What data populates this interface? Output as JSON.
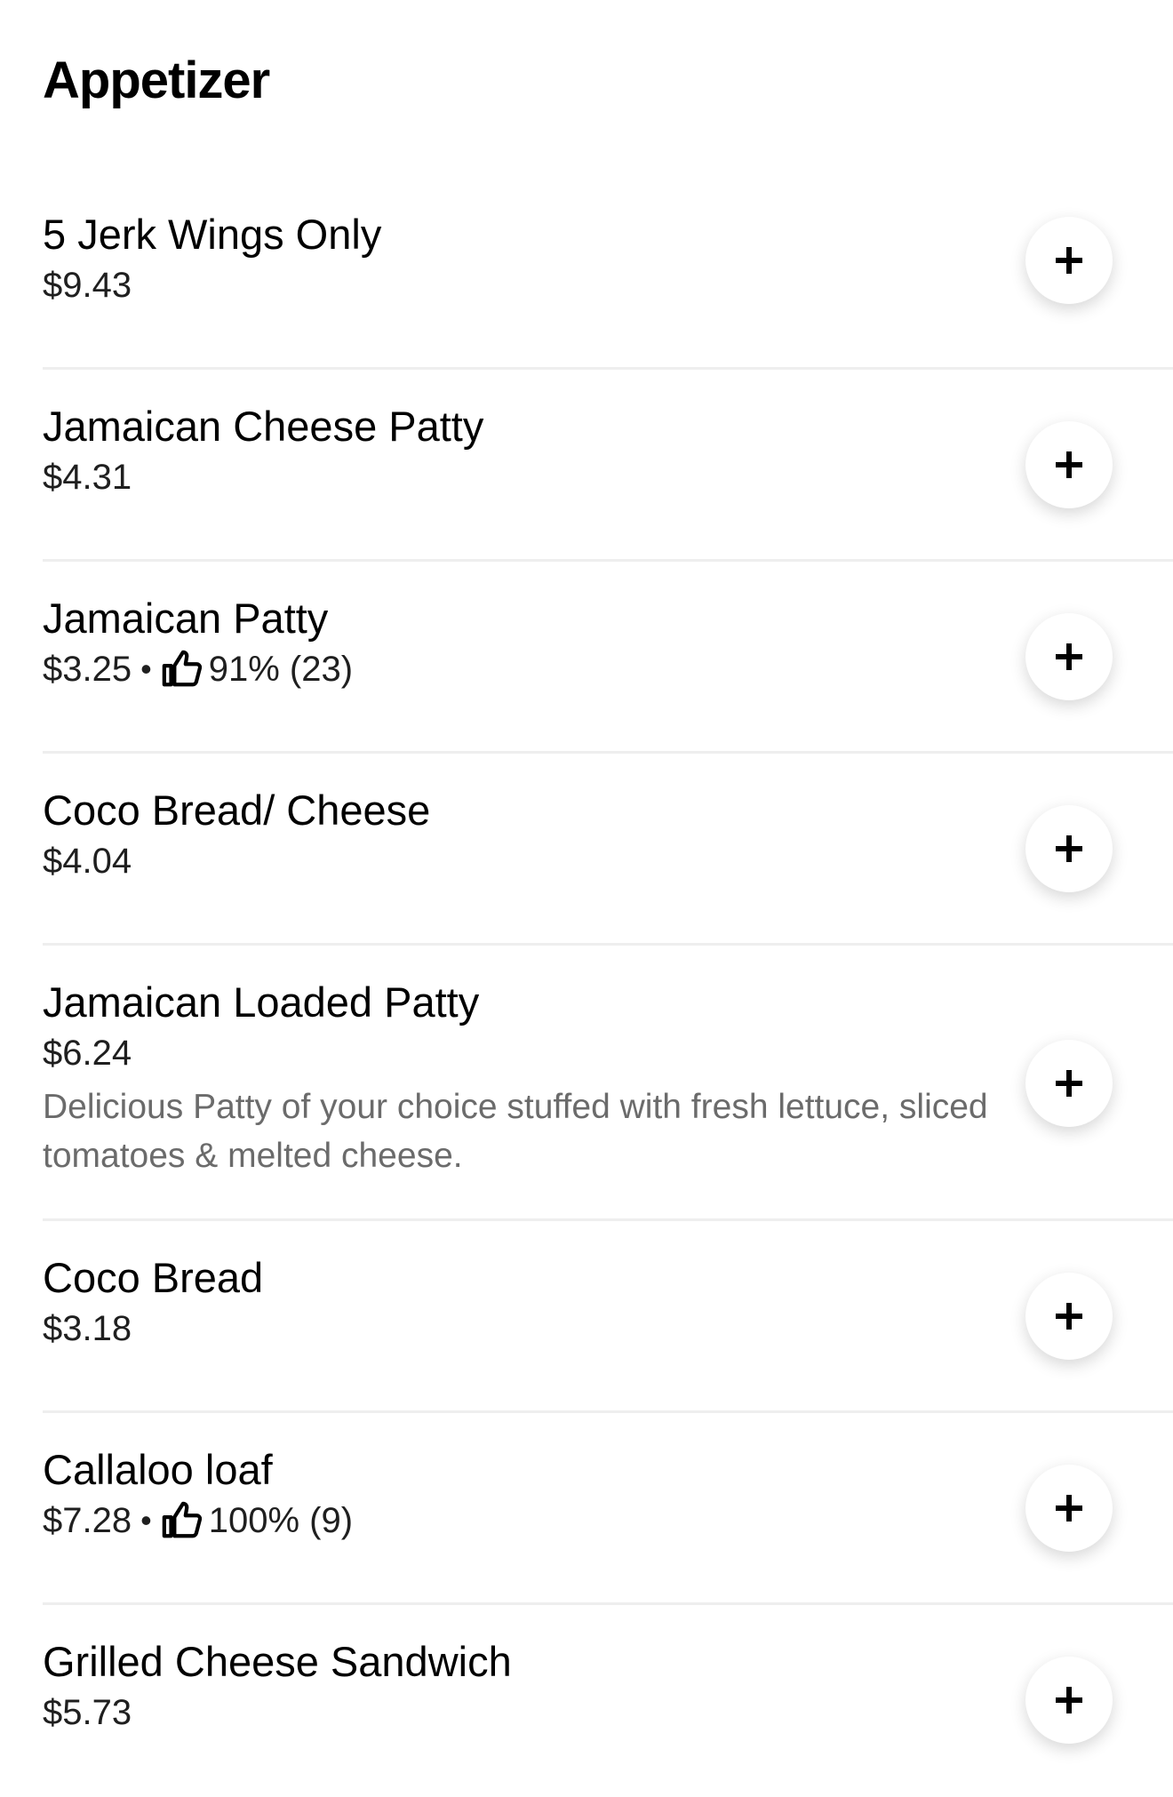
{
  "section": {
    "title": "Appetizer"
  },
  "items": [
    {
      "name": "5 Jerk Wings Only",
      "price": "$9.43"
    },
    {
      "name": "Jamaican Cheese Patty",
      "price": "$4.31"
    },
    {
      "name": "Jamaican Patty",
      "price": "$3.25",
      "separator": "•",
      "rating": "91% (23)",
      "rating_icon": "thumbs-up-icon"
    },
    {
      "name": "Coco Bread/ Cheese",
      "price": "$4.04"
    },
    {
      "name": "Jamaican Loaded Patty",
      "price": "$6.24",
      "description": "Delicious Patty of your choice stuffed with fresh lettuce, sliced tomatoes & melted cheese."
    },
    {
      "name": "Coco Bread",
      "price": "$3.18"
    },
    {
      "name": "Callaloo loaf",
      "price": "$7.28",
      "separator": "•",
      "rating": "100% (9)",
      "rating_icon": "thumbs-up-icon"
    },
    {
      "name": "Grilled Cheese Sandwich",
      "price": "$5.73"
    }
  ],
  "add_button_icon": "plus-icon",
  "colors": {
    "text_primary": "#000000",
    "text_secondary": "#6b6b6b",
    "divider": "#eeeeee",
    "button_bg": "#ffffff"
  }
}
